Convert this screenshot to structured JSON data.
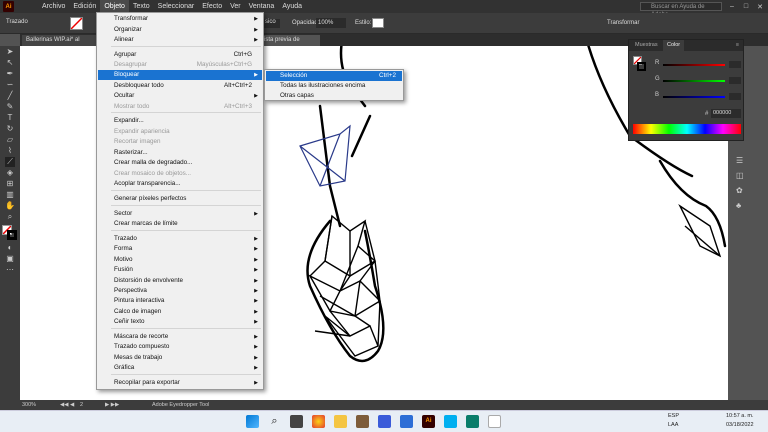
{
  "app": {
    "logo": "Ai",
    "menus": [
      "Archivo",
      "Edición",
      "Objeto",
      "Texto",
      "Seleccionar",
      "Efecto",
      "Ver",
      "Ventana",
      "Ayuda"
    ],
    "active_menu": "Objeto",
    "search_placeholder": "Buscar en Ayuda de Adobe"
  },
  "control_bar": {
    "left_label": "Trazado",
    "style_value": "sico",
    "opacity_label": "Opacidad:",
    "opacity_value": "100%",
    "style_label": "Estilo:",
    "transform_label": "Transformar"
  },
  "tabs": {
    "doc_tab": "Ballerinas WIP.ai* al 8.33%",
    "preview_tab": "ista previa de CPU)"
  },
  "object_menu": {
    "items": [
      {
        "label": "Transformar",
        "shortcut": "",
        "arrow": true,
        "disabled": false
      },
      {
        "label": "Organizar",
        "shortcut": "",
        "arrow": true,
        "disabled": false
      },
      {
        "label": "Alinear",
        "shortcut": "",
        "arrow": true,
        "disabled": false
      },
      {
        "label": "Agrupar",
        "shortcut": "Ctrl+G",
        "arrow": false,
        "disabled": false
      },
      {
        "label": "Desagrupar",
        "shortcut": "Mayúsculas+Ctrl+G",
        "arrow": false,
        "disabled": true
      },
      {
        "label": "Bloquear",
        "shortcut": "",
        "arrow": true,
        "disabled": false,
        "highlighted": true
      },
      {
        "label": "Desbloquear todo",
        "shortcut": "Alt+Ctrl+2",
        "arrow": false,
        "disabled": false
      },
      {
        "label": "Ocultar",
        "shortcut": "",
        "arrow": true,
        "disabled": false
      },
      {
        "label": "Mostrar todo",
        "shortcut": "Alt+Ctrl+3",
        "arrow": false,
        "disabled": true
      },
      {
        "label": "Expandir...",
        "shortcut": "",
        "arrow": false,
        "disabled": false
      },
      {
        "label": "Expandir apariencia",
        "shortcut": "",
        "arrow": false,
        "disabled": true
      },
      {
        "label": "Recortar imagen",
        "shortcut": "",
        "arrow": false,
        "disabled": true
      },
      {
        "label": "Rasterizar...",
        "shortcut": "",
        "arrow": false,
        "disabled": false
      },
      {
        "label": "Crear malla de degradado...",
        "shortcut": "",
        "arrow": false,
        "disabled": false
      },
      {
        "label": "Crear mosaico de objetos...",
        "shortcut": "",
        "arrow": false,
        "disabled": true
      },
      {
        "label": "Acoplar transparencia...",
        "shortcut": "",
        "arrow": false,
        "disabled": false
      },
      {
        "label": "Generar píxeles perfectos",
        "shortcut": "",
        "arrow": false,
        "disabled": false
      },
      {
        "label": "Sector",
        "shortcut": "",
        "arrow": true,
        "disabled": false
      },
      {
        "label": "Crear marcas de límite",
        "shortcut": "",
        "arrow": false,
        "disabled": false
      },
      {
        "label": "Trazado",
        "shortcut": "",
        "arrow": true,
        "disabled": false
      },
      {
        "label": "Forma",
        "shortcut": "",
        "arrow": true,
        "disabled": false
      },
      {
        "label": "Motivo",
        "shortcut": "",
        "arrow": true,
        "disabled": false
      },
      {
        "label": "Fusión",
        "shortcut": "",
        "arrow": true,
        "disabled": false
      },
      {
        "label": "Distorsión de envolvente",
        "shortcut": "",
        "arrow": true,
        "disabled": false
      },
      {
        "label": "Perspectiva",
        "shortcut": "",
        "arrow": true,
        "disabled": false
      },
      {
        "label": "Pintura interactiva",
        "shortcut": "",
        "arrow": true,
        "disabled": false
      },
      {
        "label": "Calco de imagen",
        "shortcut": "",
        "arrow": true,
        "disabled": false
      },
      {
        "label": "Ceñir texto",
        "shortcut": "",
        "arrow": true,
        "disabled": false
      },
      {
        "label": "Máscara de recorte",
        "shortcut": "",
        "arrow": true,
        "disabled": false
      },
      {
        "label": "Trazado compuesto",
        "shortcut": "",
        "arrow": true,
        "disabled": false
      },
      {
        "label": "Mesas de trabajo",
        "shortcut": "",
        "arrow": true,
        "disabled": false
      },
      {
        "label": "Gráfica",
        "shortcut": "",
        "arrow": true,
        "disabled": false
      },
      {
        "label": "Recopilar para exportar",
        "shortcut": "",
        "arrow": true,
        "disabled": false
      }
    ]
  },
  "lock_submenu": {
    "items": [
      {
        "label": "Selección",
        "shortcut": "Ctrl+2",
        "highlighted": true
      },
      {
        "label": "Todas las ilustraciones encima",
        "shortcut": ""
      },
      {
        "label": "Otras capas",
        "shortcut": ""
      }
    ]
  },
  "color_panel": {
    "tabs": [
      "Muestras",
      "Color"
    ],
    "active_tab": "Color",
    "channels": [
      "R",
      "G",
      "B"
    ],
    "hex_label": "#",
    "hex_value": "000000"
  },
  "status": {
    "zoom": "300%",
    "page": "2",
    "tool_name": "Adobe Eyedropper Tool"
  },
  "taskbar": {
    "lang": "ESP",
    "lang2": "LAA",
    "time": "10:57 a. m.",
    "date": "03/18/2022"
  },
  "colors": {
    "highlight": "#1a73d1",
    "ai_orange": "#ff9a00"
  }
}
